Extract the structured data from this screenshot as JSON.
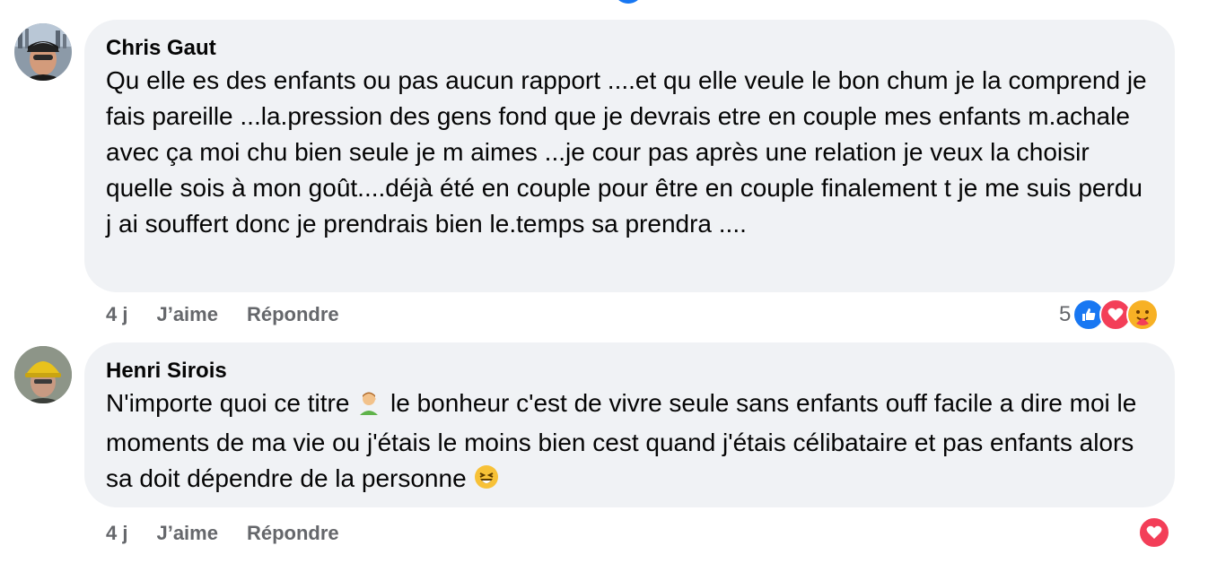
{
  "comments": [
    {
      "author": "Chris Gaut",
      "text": "Qu elle es des enfants ou pas aucun rapport ....et qu elle veule le bon chum je la comprend je fais pareille ...la.pression des gens fond que je devrais etre en couple mes enfants m.achale avec ça moi chu bien seule je m aimes ...je cour pas après une relation je veux la choisir quelle sois à mon goût....déjà été en couple pour être en couple finalement t je me suis perdu j ai souffert donc je prendrais bien le.temps sa prendra ....",
      "time": "4 j",
      "like_label": "J’aime",
      "reply_label": "Répondre",
      "reaction_count": "5",
      "reactions": [
        "like-icon",
        "love-icon",
        "care-icon"
      ]
    },
    {
      "author": "Henri Sirois",
      "text_parts": [
        "N'importe quoi ce titre ",
        " le bonheur c'est de vivre seule sans enfants ouff facile a dire moi le moments de ma vie ou j'étais le moins bien cest quand j'étais célibataire et pas enfants alors sa doit dépendre de la personne "
      ],
      "emojis": [
        "facepalm-emoji",
        "laughing-emoji"
      ],
      "time": "4 j",
      "like_label": "J’aime",
      "reply_label": "Répondre",
      "reactions": [
        "love-icon"
      ]
    }
  ],
  "colors": {
    "bubble": "#f0f2f5",
    "meta": "#65676b",
    "like": "#1877f2",
    "love": "#f33e58",
    "care": "#f7b125"
  }
}
